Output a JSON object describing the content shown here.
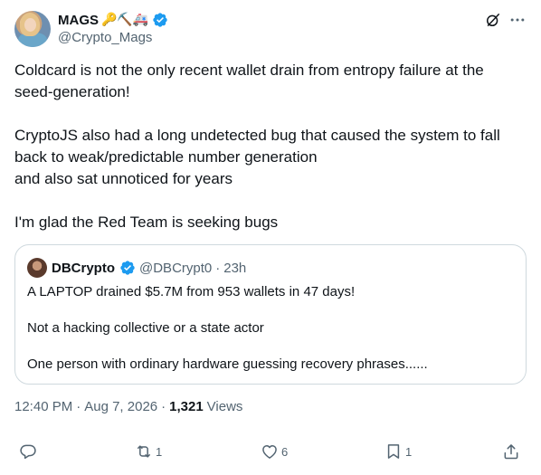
{
  "author": {
    "display_name": "MAGS",
    "emojis": "🔑⛏️🚑",
    "handle": "@Crypto_Mags"
  },
  "tweet": {
    "paragraphs": [
      "Coldcard is not the only recent wallet drain from entropy failure at the",
      "seed-generation!",
      "",
      "CryptoJS also had a long undetected bug that caused the system to fall",
      "back to weak/predictable number generation",
      "and also sat unnoticed for years",
      "",
      "I'm glad the Red Team is seeking bugs"
    ]
  },
  "quote": {
    "display_name": "DBCrypto",
    "handle": "@DBCrypt0",
    "dot": "·",
    "time": "23h",
    "lines": [
      "A LAPTOP drained $5.7M from 953 wallets in 47 days!",
      "",
      "Not a hacking collective or a state actor",
      "",
      "One person with ordinary hardware guessing recovery phrases......"
    ]
  },
  "meta": {
    "time": "12:40 PM",
    "sep": "·",
    "date": "Aug 7, 2026",
    "views_count": "1,321",
    "views_label": "Views"
  },
  "actions": {
    "reply_count": "",
    "retweet_count": "1",
    "like_count": "6",
    "bookmark_count": "1"
  },
  "colors": {
    "verified": "#1d9bf0",
    "secondary_text": "#536471",
    "border": "#cfd9de"
  }
}
